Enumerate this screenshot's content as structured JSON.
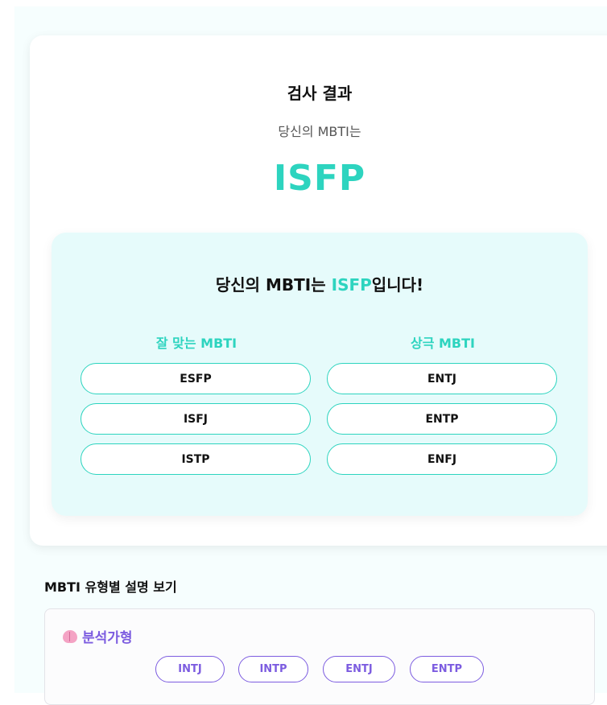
{
  "result": {
    "title": "검사 결과",
    "subtitle": "당신의 MBTI는",
    "type": "ISFP"
  },
  "match": {
    "headline_prefix": "당신의 MBTI는 ",
    "headline_type": "ISFP",
    "headline_suffix": "입니다!",
    "good": {
      "title": "잘 맞는 MBTI",
      "items": [
        "ESFP",
        "ISFJ",
        "ISTP"
      ]
    },
    "bad": {
      "title": "상극 MBTI",
      "items": [
        "ENTJ",
        "ENTP",
        "ENFJ"
      ]
    }
  },
  "descriptions": {
    "section_title": "MBTI 유형별 설명 보기",
    "group": {
      "icon": "brain-icon",
      "title": "분석가형",
      "types": [
        "INTJ",
        "INTP",
        "ENTJ",
        "ENTP"
      ]
    }
  },
  "colors": {
    "accent": "#2dd4bf",
    "analyst": "#7c5ce0"
  }
}
